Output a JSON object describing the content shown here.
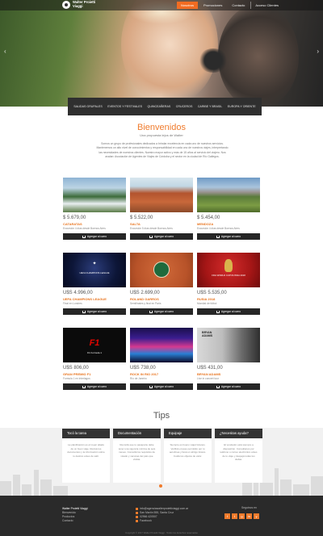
{
  "header": {
    "logo_line1": "Walter Proietti",
    "logo_line2": "Viaggi",
    "nav": [
      "Nosotros",
      "Promociones",
      "Contacto",
      "Acceso Clientes"
    ],
    "nav_active_index": 0,
    "accent_color": "#f26c22"
  },
  "hero": {
    "prev_icon": "‹",
    "next_icon": "›"
  },
  "categories": [
    "Salidas grupales",
    "Eventos y festivales",
    "Quinceañeras",
    "Cruceros",
    "Caribe y Brasil",
    "Europa y Oriente"
  ],
  "welcome": {
    "title": "Bienvenidos",
    "subtitle": "Una propuesta lejos de Walter",
    "body": "Somos un grupo de profesionales dedicados a brindar excelencia en cada uno de nuestros servicios. Mantenemos un alto nivel de conocimientos y responsabilidad en cada uno de nuestros viajes, interpretando las necesidades de nuestros clientes. Nuestro mayor activo y más de 15 años al servicio del viajero. Nos avalan: Asociación de Agentes de Viajes de Córdoba y el sector en la ciudad de Río Gallegos."
  },
  "add_to_cart_label": "Agregar al carro",
  "products": [
    {
      "price": "$ 5.679,00",
      "title": "Cataratas",
      "desc": "Excursión 4 días desde Buenos Aires",
      "img": "waterfalls"
    },
    {
      "price": "$ 5.522,00",
      "title": "Salta",
      "desc": "Excursión 5 días desde Buenos Aires",
      "img": "canyon"
    },
    {
      "price": "$ 5.454,00",
      "title": "Mendoza",
      "desc": "Excursión 4 días desde Buenos Aires",
      "img": "vineyard"
    },
    {
      "price": "U$S 4.996,00",
      "title": "UEFA Champions League",
      "desc": "Final en Londres",
      "img": "ucl",
      "img_text": "UEFA CHAMPIONS LEAGUE"
    },
    {
      "price": "U$S 2.699,00",
      "title": "Roland Garros",
      "desc": "Semifinales y final en París",
      "img": "clay"
    },
    {
      "price": "U$S 5.535,00",
      "title": "Rusia 2018",
      "desc": "Mundial de fútbol",
      "img": "russia",
      "img_text": "FIFA WORLD CUP RUSSIA 2018"
    },
    {
      "price": "U$S 806,00",
      "title": "Gran Premio F1",
      "desc": "Formula 1 en Interlagos",
      "img": "f1",
      "img_text": "F1 Formula 1"
    },
    {
      "price": "U$S 738,00",
      "title": "Rock in Rio 2017",
      "desc": "Río de Janeiro",
      "img": "concert"
    },
    {
      "price": "U$S 431,00",
      "title": "Bryan Adams",
      "desc": "Live in concert tour",
      "img": "bryan",
      "img_text": "BRYAN ADAMS"
    }
  ],
  "tips_title": "Tips",
  "tips": [
    {
      "title": "Tocó la tarea",
      "body": "La planificación es el mejor aliado de un buen viaje. Revisá tus documentos y la información sobre tu destino antes de salir."
    },
    {
      "title": "Documentación",
      "body": "Recordá que tu pasaporte debe tener una vigencia mínima de seis meses. Consultá los requisitos de visado y vacunas del país que visitás."
    },
    {
      "title": "Equipaje",
      "body": "Siempre es bueno viajar livianos. Verificá el peso permitido por tu aerolínea y llevá un abrigo liviano. Cuidá los objetos de valor."
    },
    {
      "title": "¿Necesitas ayuda?",
      "body": "El vendedor está siempre a disposición. Consultanos por teléfono o correo electrónico antes de tu viaje y despejá todas tus dudas."
    }
  ],
  "footer": {
    "col1": [
      "Walter Proietti Viaggi",
      "Bienvenido",
      "Productos",
      "Contacto"
    ],
    "contact": [
      "info@agenciawalterproiettiviaggi.com.ar",
      "San Martín 555, Santa Cruz",
      "02966 420507",
      "Facebook"
    ],
    "social_label": "Seguinos en",
    "social": [
      "f",
      "t",
      "g",
      "in",
      "y"
    ],
    "copyright": "Copyright © 2017 Walter Proietti Viaggi · Todos los derechos reservados"
  }
}
